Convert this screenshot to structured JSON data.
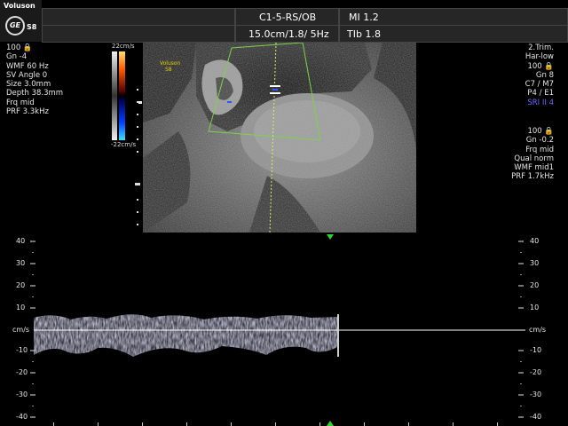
{
  "header": {
    "brand": "Voluson",
    "logo": "GE",
    "model": "S8",
    "probe": "C1-5-RS/OB",
    "mi": "MI  1.2",
    "depth_freq": "15.0cm/1.8/ 5Hz",
    "tib": "TIb  1.8"
  },
  "left_panel": {
    "lines": [
      "100 🔒",
      "Gn  -4",
      "WMF 60 Hz",
      "SV Angle  0",
      "Size  3.0mm",
      "Depth 38.3mm",
      "Frq mid",
      "PRF  3.3kHz"
    ]
  },
  "colorbar": {
    "top_label": "22cm/s",
    "bottom_label": "-22cm/s"
  },
  "image_overlay": {
    "line1": "Voluson",
    "line2": "S8"
  },
  "right_panel": {
    "lines": [
      "2.Trim.",
      "Har-low",
      "100 🔒",
      "Gn  8",
      "C7 / M7",
      "P4 / E1"
    ],
    "highlight": "SRI II 4"
  },
  "right_panel2": {
    "lines": [
      "100 🔒",
      "Gn -0.2",
      "Frq mid",
      "Qual norm",
      "WMF mid1",
      "PRF  1.7kHz"
    ]
  },
  "spectrum": {
    "unit": "cm/s",
    "scale": [
      "40",
      "30",
      "20",
      "10",
      "cm/s",
      "-10",
      "-20",
      "-30",
      "-40"
    ]
  },
  "colors": {
    "background": "#000000",
    "header_cell": "#262626",
    "roi_box": "#7cd24a",
    "baseline": "#ffffff",
    "marker": "#2ed12e"
  }
}
